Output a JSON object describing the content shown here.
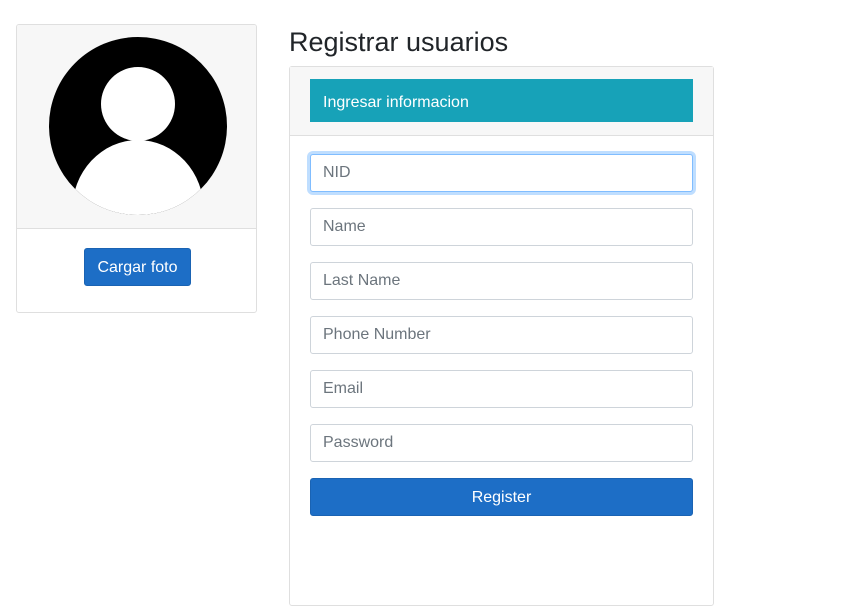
{
  "page": {
    "title": "Registrar usuarios"
  },
  "photo_panel": {
    "avatar_icon": "user-avatar-icon",
    "upload_label": "Cargar foto"
  },
  "form": {
    "header": "Ingresar informacion",
    "fields": [
      {
        "placeholder": "NID",
        "value": "",
        "focused": true
      },
      {
        "placeholder": "Name",
        "value": ""
      },
      {
        "placeholder": "Last Name",
        "value": ""
      },
      {
        "placeholder": "Phone Number",
        "value": ""
      },
      {
        "placeholder": "Email",
        "value": ""
      },
      {
        "placeholder": "Password",
        "value": ""
      }
    ],
    "submit_label": "Register"
  },
  "colors": {
    "primary": "#1d6ec6",
    "info": "#17a2b8",
    "panel_bg": "#f7f7f7",
    "focus_border": "#80bdff"
  }
}
